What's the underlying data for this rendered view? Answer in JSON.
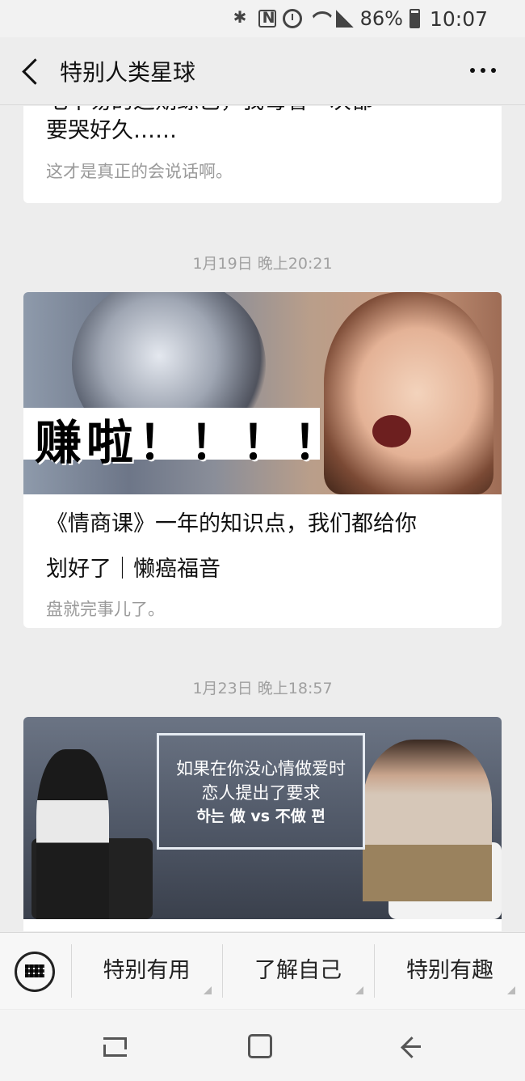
{
  "status_bar": {
    "battery": "86%",
    "time": "10:07"
  },
  "header": {
    "title": "特别人类星球"
  },
  "articles": [
    {
      "title_line1": "毛不易的这期综艺，我每看一次都",
      "title_line2": "要哭好久……",
      "digest": "这才是真正的会说话啊。"
    },
    {
      "time": "1月19日 晚上20:21",
      "cover_text": "赚啦！！！！",
      "title_line1": "《情商课》一年的知识点，我们都给你",
      "title_line2": "划好了｜懒癌福音",
      "digest": "盘就完事儿了。"
    },
    {
      "time": "1月23日 晚上18:57",
      "cover_subtitle1": "如果在你没心情做爱时",
      "cover_subtitle2": "恋人提出了要求",
      "cover_subtitle3": "하는 做 vs 不做 편"
    }
  ],
  "menu": {
    "items": [
      "特别有用",
      "了解自己",
      "特别有趣"
    ]
  },
  "icons": {
    "status": [
      "bluetooth-icon",
      "nfc-icon",
      "alarm-icon",
      "wifi-icon",
      "signal-icon",
      "battery-icon"
    ],
    "header": [
      "back-arrow-icon",
      "more-icon"
    ],
    "menu": [
      "keyboard-icon"
    ],
    "nav": [
      "recent-apps-icon",
      "home-icon",
      "back-icon"
    ]
  }
}
